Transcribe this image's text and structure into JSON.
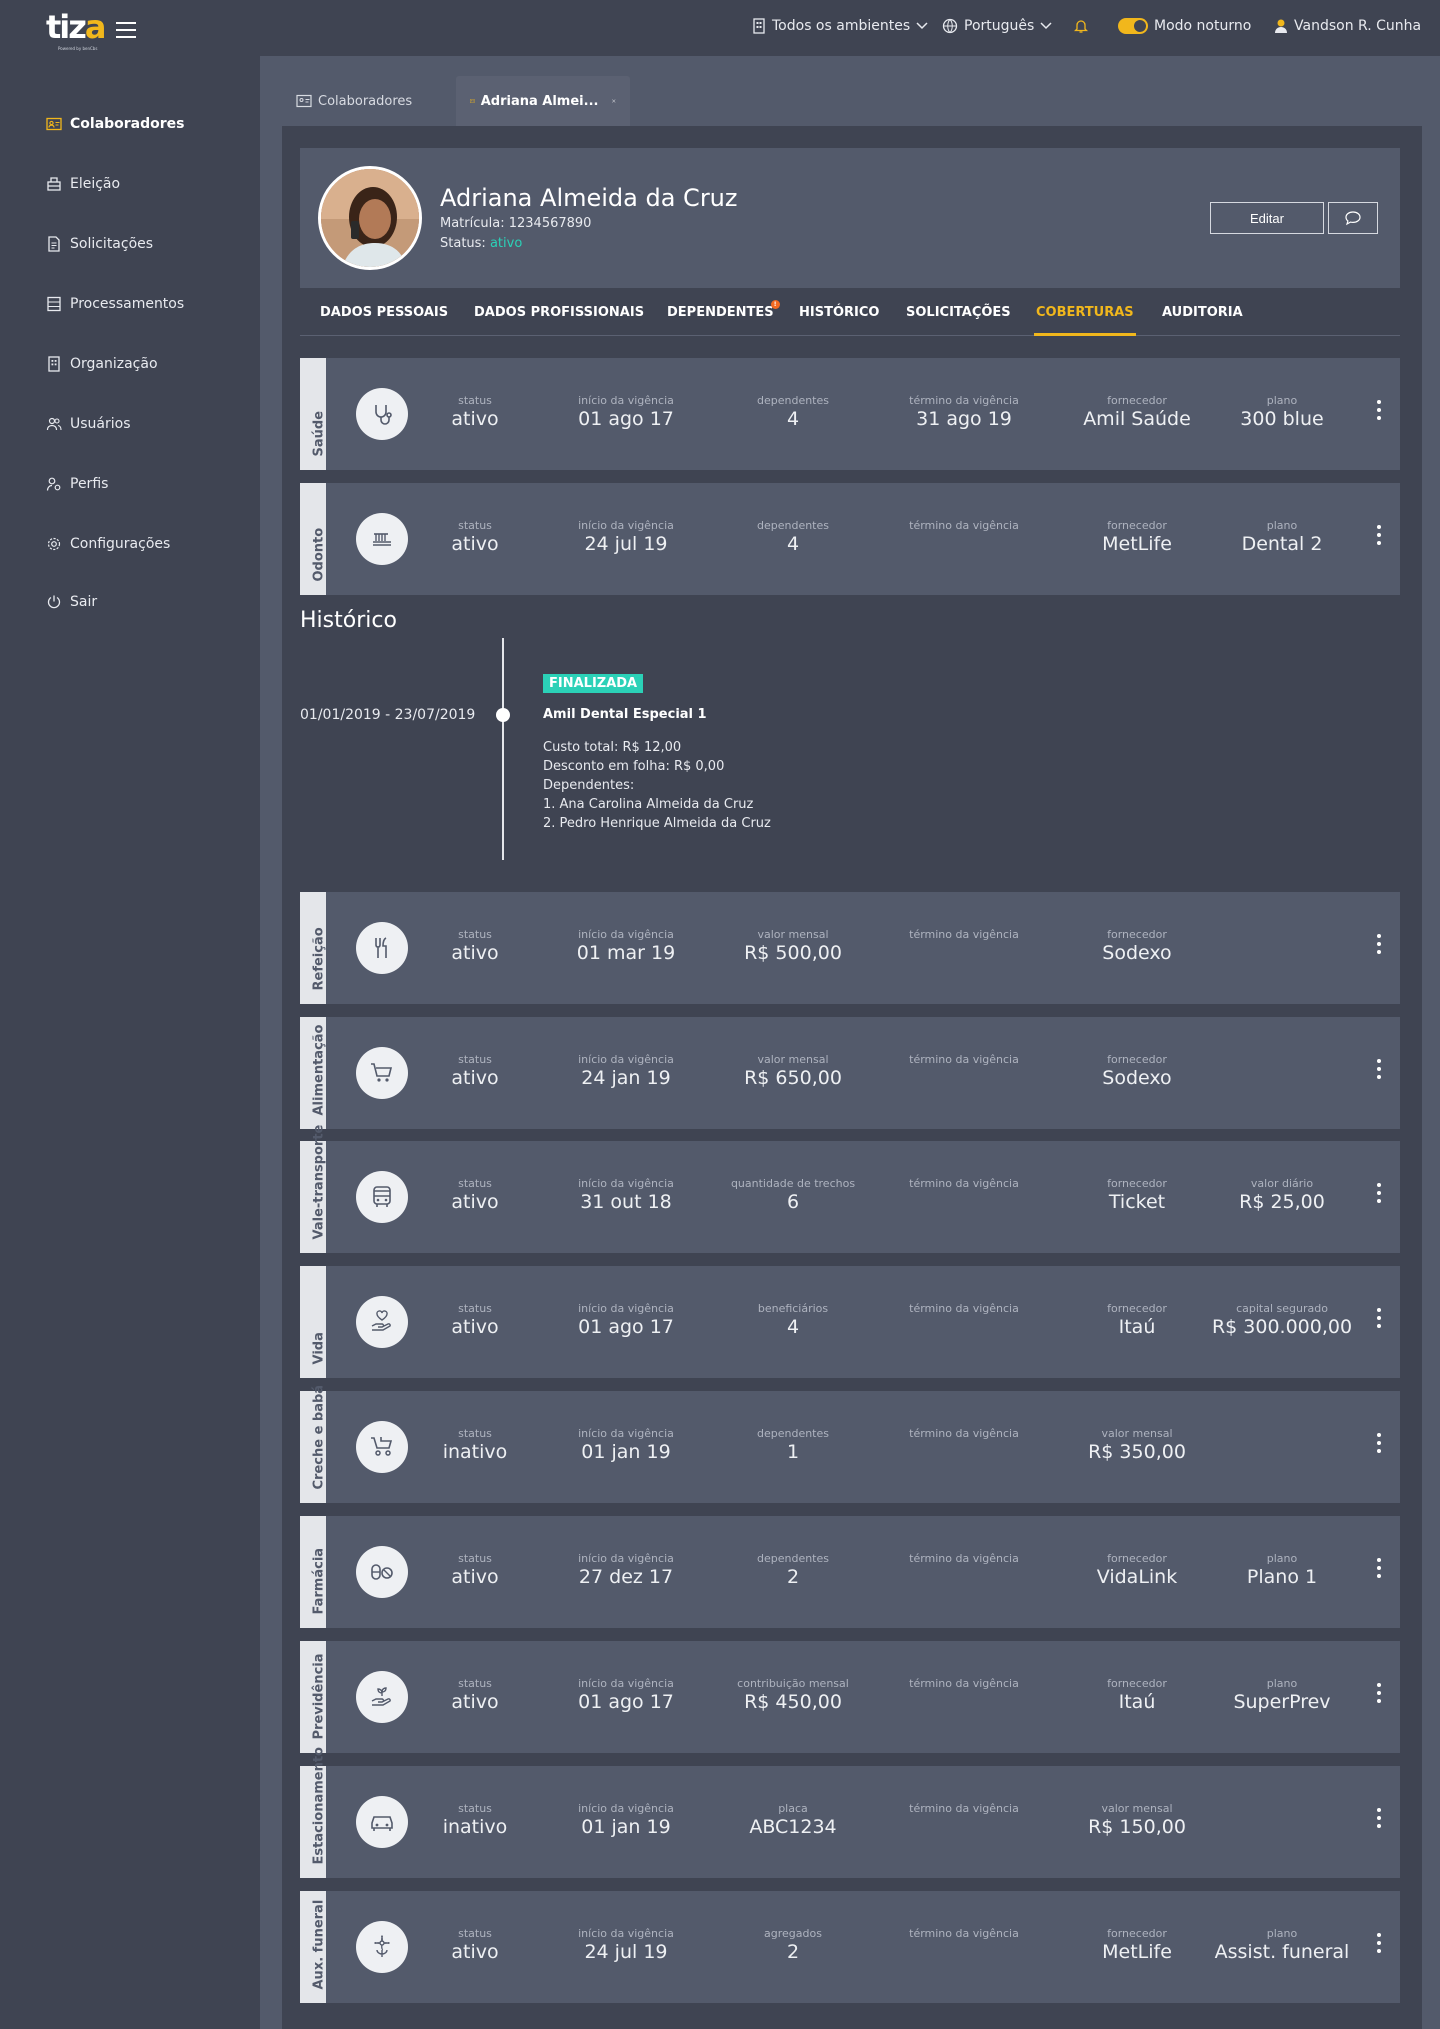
{
  "topbar": {
    "logo_text": "tiza",
    "logo_sub": "Powered by benCbs",
    "environment": "Todos os ambientes",
    "language": "Português",
    "dark_mode_label": "Modo noturno",
    "user": "Vandson R. Cunha"
  },
  "sidebar": {
    "items": [
      {
        "label": "Colaboradores",
        "icon": "id-card-icon",
        "active": true
      },
      {
        "label": "Eleição",
        "icon": "ballot-box-icon"
      },
      {
        "label": "Solicitações",
        "icon": "document-icon"
      },
      {
        "label": "Processamentos",
        "icon": "server-icon"
      },
      {
        "label": "Organização",
        "icon": "building-icon"
      },
      {
        "label": "Usuários",
        "icon": "users-icon"
      },
      {
        "label": "Perfis",
        "icon": "user-gear-icon"
      },
      {
        "label": "Configurações",
        "icon": "gear-icon"
      },
      {
        "label": "Sair",
        "icon": "power-icon"
      }
    ]
  },
  "tabs": [
    {
      "label": "Colaboradores"
    },
    {
      "label": "Adriana Almei..."
    }
  ],
  "profile": {
    "name": "Adriana Almeida da Cruz",
    "matricula_label": "Matrícula:",
    "matricula": "1234567890",
    "status_label": "Status:",
    "status": "ativo",
    "edit_label": "Editar"
  },
  "profile_tabs": [
    "DADOS PESSOAIS",
    "DADOS PROFISSIONAIS",
    "DEPENDENTES",
    "HISTÓRICO",
    "SOLICITAÇÕES",
    "COBERTURAS",
    "AUDITORIA"
  ],
  "dependentes_badge": "!",
  "active_profile_tab": "COBERTURAS",
  "colors": {
    "accent": "#f1b71c",
    "ok": "#2bd1b7",
    "warn": "#f26a22"
  },
  "coverages": [
    {
      "name": "Saúde",
      "icon": "stethoscope-icon",
      "fields": [
        {
          "label": "status",
          "value": "ativo",
          "tone": "ok"
        },
        {
          "label": "início da vigência",
          "value": "01 ago 17"
        },
        {
          "label": "dependentes",
          "value": "4"
        },
        {
          "label": "término da vigência",
          "value": "31 ago 19",
          "tone": "warn"
        },
        {
          "label": "fornecedor",
          "value": "Amil Saúde"
        },
        {
          "label": "plano",
          "value": "300 blue"
        }
      ]
    },
    {
      "name": "Odonto",
      "icon": "toothbrush-icon",
      "fields": [
        {
          "label": "status",
          "value": "ativo",
          "tone": "ok"
        },
        {
          "label": "início da vigência",
          "value": "24 jul 19"
        },
        {
          "label": "dependentes",
          "value": "4"
        },
        {
          "label": "término da vigência",
          "value": ""
        },
        {
          "label": "fornecedor",
          "value": "MetLife"
        },
        {
          "label": "plano",
          "value": "Dental 2"
        }
      ]
    },
    {
      "name": "Refeição",
      "icon": "fork-knife-icon",
      "fields": [
        {
          "label": "status",
          "value": "ativo",
          "tone": "ok"
        },
        {
          "label": "início da vigência",
          "value": "01 mar 19"
        },
        {
          "label": "valor mensal",
          "value": "R$ 500,00"
        },
        {
          "label": "término da vigência",
          "value": ""
        },
        {
          "label": "fornecedor",
          "value": "Sodexo"
        },
        {
          "label": "",
          "value": ""
        }
      ]
    },
    {
      "name": "Alimentação",
      "icon": "cart-icon",
      "fields": [
        {
          "label": "status",
          "value": "ativo",
          "tone": "ok"
        },
        {
          "label": "início da vigência",
          "value": "24 jan 19"
        },
        {
          "label": "valor mensal",
          "value": "R$ 650,00"
        },
        {
          "label": "término da vigência",
          "value": ""
        },
        {
          "label": "fornecedor",
          "value": "Sodexo"
        },
        {
          "label": "",
          "value": ""
        }
      ]
    },
    {
      "name": "Vale-transporte",
      "icon": "bus-icon",
      "fields": [
        {
          "label": "status",
          "value": "ativo",
          "tone": "ok"
        },
        {
          "label": "início da vigência",
          "value": "31 out 18"
        },
        {
          "label": "quantidade de trechos",
          "value": "6"
        },
        {
          "label": "término da vigência",
          "value": ""
        },
        {
          "label": "fornecedor",
          "value": "Ticket"
        },
        {
          "label": "valor diário",
          "value": "R$ 25,00"
        }
      ]
    },
    {
      "name": "Vida",
      "icon": "heart-hand-icon",
      "fields": [
        {
          "label": "status",
          "value": "ativo",
          "tone": "ok"
        },
        {
          "label": "início da vigência",
          "value": "01 ago 17"
        },
        {
          "label": "beneficiários",
          "value": "4"
        },
        {
          "label": "término da vigência",
          "value": ""
        },
        {
          "label": "fornecedor",
          "value": "Itaú"
        },
        {
          "label": "capital segurado",
          "value": "R$ 300.000,00"
        }
      ]
    },
    {
      "name": "Creche e babá",
      "icon": "stroller-icon",
      "fields": [
        {
          "label": "status",
          "value": "inativo",
          "tone": "warn"
        },
        {
          "label": "início da vigência",
          "value": "01 jan 19"
        },
        {
          "label": "dependentes",
          "value": "1"
        },
        {
          "label": "término da vigência",
          "value": ""
        },
        {
          "label": "valor mensal",
          "value": "R$ 350,00"
        },
        {
          "label": "",
          "value": ""
        }
      ]
    },
    {
      "name": "Farmácia",
      "icon": "pills-icon",
      "fields": [
        {
          "label": "status",
          "value": "ativo",
          "tone": "ok"
        },
        {
          "label": "início da vigência",
          "value": "27 dez 17"
        },
        {
          "label": "dependentes",
          "value": "2"
        },
        {
          "label": "término da vigência",
          "value": ""
        },
        {
          "label": "fornecedor",
          "value": "VidaLink"
        },
        {
          "label": "plano",
          "value": "Plano 1"
        }
      ]
    },
    {
      "name": "Previdência",
      "icon": "plant-hand-icon",
      "fields": [
        {
          "label": "status",
          "value": "ativo",
          "tone": "ok"
        },
        {
          "label": "início da vigência",
          "value": "01 ago 17"
        },
        {
          "label": "contribuição mensal",
          "value": "R$ 450,00"
        },
        {
          "label": "término da vigência",
          "value": ""
        },
        {
          "label": "fornecedor",
          "value": "Itaú"
        },
        {
          "label": "plano",
          "value": "SuperPrev"
        }
      ]
    },
    {
      "name": "Estacionamento",
      "icon": "car-icon",
      "fields": [
        {
          "label": "status",
          "value": "inativo",
          "tone": "warn"
        },
        {
          "label": "início da vigência",
          "value": "01 jan 19"
        },
        {
          "label": "placa",
          "value": "ABC1234"
        },
        {
          "label": "término da vigência",
          "value": ""
        },
        {
          "label": "valor mensal",
          "value": "R$ 150,00"
        },
        {
          "label": "",
          "value": ""
        }
      ]
    },
    {
      "name": "Aux. funeral",
      "icon": "flower-icon",
      "fields": [
        {
          "label": "status",
          "value": "ativo",
          "tone": "ok"
        },
        {
          "label": "início da vigência",
          "value": "24 jul 19"
        },
        {
          "label": "agregados",
          "value": "2"
        },
        {
          "label": "término da vigência",
          "value": ""
        },
        {
          "label": "fornecedor",
          "value": "MetLife"
        },
        {
          "label": "plano",
          "value": "Assist. funeral"
        }
      ]
    }
  ],
  "historico": {
    "title": "Histórico",
    "period": "01/01/2019 - 23/07/2019",
    "badge": "FINALIZADA",
    "plan": "Amil Dental Especial 1",
    "lines": [
      "Custo total: R$ 12,00",
      "Desconto em folha: R$ 0,00",
      "Dependentes:",
      "1.  Ana Carolina Almeida da Cruz",
      "2. Pedro Henrique Almeida da Cruz"
    ]
  }
}
